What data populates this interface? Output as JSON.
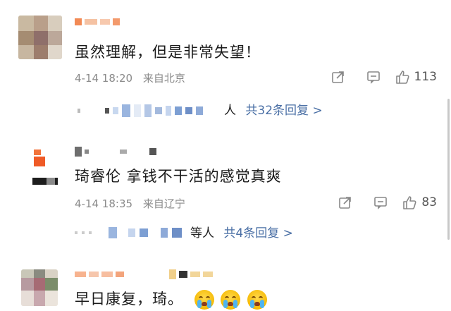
{
  "comments": [
    {
      "text": "虽然理解，但是非常失望！",
      "date": "4-14 18:20",
      "location": "来自北京",
      "likes": "113",
      "replies": "共32条回复 >",
      "reply_prefix": "人"
    },
    {
      "text": "琦睿伦 拿钱不干活的感觉真爽",
      "date": "4-14 18:35",
      "location": "来自辽宁",
      "likes": "83",
      "replies": "共4条回复 >",
      "reply_prefix": "等人"
    },
    {
      "text": "早日康复，琦。"
    }
  ],
  "icons": {
    "share": "share-icon",
    "comment": "comment-icon",
    "like": "thumbs-up-icon",
    "emoji": "crying-face-emoji"
  },
  "colors": {
    "link": "#4a6fa5",
    "meta": "#8a8a8a",
    "text": "#1a1a1a",
    "background": "#ffffff"
  }
}
